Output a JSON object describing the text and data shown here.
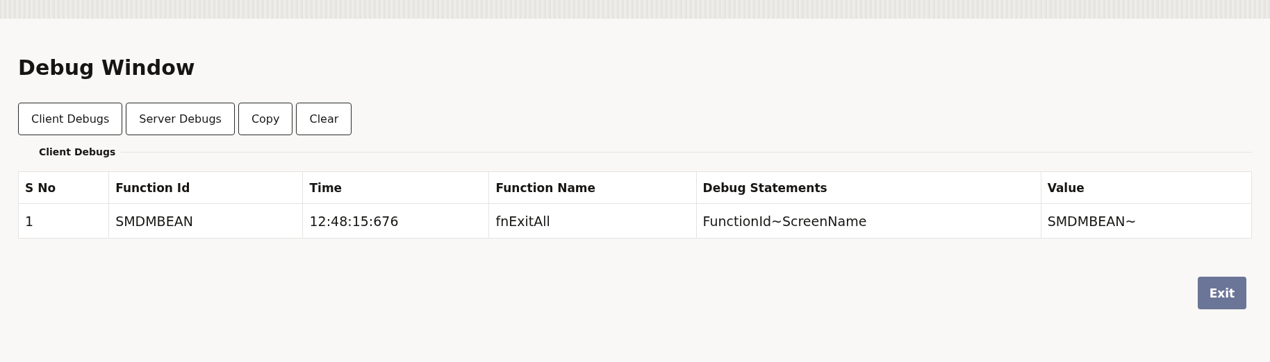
{
  "window": {
    "title": "Debug Window"
  },
  "toolbar": {
    "buttons": [
      "Client Debugs",
      "Server Debugs",
      "Copy",
      "Clear"
    ]
  },
  "section": {
    "title": "Client Debugs"
  },
  "table": {
    "columns": [
      "S No",
      "Function Id",
      "Time",
      "Function Name",
      "Debug Statements",
      "Value"
    ],
    "rows": [
      [
        "1",
        "SMDMBEAN",
        "12:48:15:676",
        "fnExitAll",
        "FunctionId~ScreenName",
        "SMDMBEAN~"
      ]
    ]
  },
  "footer": {
    "buttons": [
      "Exit"
    ]
  }
}
